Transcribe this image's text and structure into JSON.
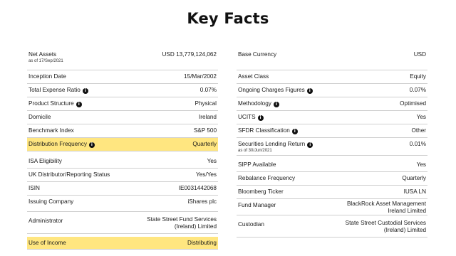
{
  "page": {
    "title": "Key Facts"
  },
  "icons": {
    "info": "info-icon"
  },
  "left": [
    {
      "label": "Net Assets",
      "sub": "as of 17/Sep/2021",
      "value": "USD 13,779,124,062",
      "info": false,
      "highlight": false
    },
    {
      "label": "Inception Date",
      "value": "15/Mar/2002",
      "info": false,
      "highlight": false
    },
    {
      "label": "Total Expense Ratio",
      "value": "0.07%",
      "info": true,
      "highlight": false
    },
    {
      "label": "Product Structure",
      "value": "Physical",
      "info": true,
      "highlight": false
    },
    {
      "label": "Domicile",
      "value": "Ireland",
      "info": false,
      "highlight": false
    },
    {
      "label": "Benchmark Index",
      "value": "S&P 500",
      "info": false,
      "highlight": false
    },
    {
      "label": "Distribution Frequency",
      "value": "Quarterly",
      "info": true,
      "highlight": true
    },
    {
      "label": "ISA Eligibility",
      "value": "Yes",
      "info": false,
      "highlight": false
    },
    {
      "label": "UK Distributor/Reporting Status",
      "value": "Yes/Yes",
      "info": false,
      "highlight": false
    },
    {
      "label": "ISIN",
      "value": "IE0031442068",
      "info": false,
      "highlight": false
    },
    {
      "label": "Issuing Company",
      "value": "iShares plc",
      "info": false,
      "highlight": false
    },
    {
      "label": "Administrator",
      "value_lines": [
        "State Street Fund Services",
        "(Ireland) Limited"
      ],
      "info": false,
      "highlight": false
    },
    {
      "label": "Use of Income",
      "value": "Distributing",
      "info": false,
      "highlight": true
    }
  ],
  "right": [
    {
      "label": "Base Currency",
      "value": "USD",
      "info": false,
      "highlight": false
    },
    {
      "label": "Asset Class",
      "value": "Equity",
      "info": false,
      "highlight": false
    },
    {
      "label": "Ongoing Charges Figures",
      "value": "0.07%",
      "info": true,
      "highlight": false
    },
    {
      "label": "Methodology",
      "value": "Optimised",
      "info": true,
      "highlight": false
    },
    {
      "label": "UCITS",
      "value": "Yes",
      "info": true,
      "highlight": false
    },
    {
      "label": "SFDR Classification",
      "value": "Other",
      "info": true,
      "highlight": false
    },
    {
      "label": "Securities Lending Return",
      "sub": "as of 30/Jun/2021",
      "value": "0.01%",
      "info": true,
      "highlight": false
    },
    {
      "label": "SIPP Available",
      "value": "Yes",
      "info": false,
      "highlight": false
    },
    {
      "label": "Rebalance Frequency",
      "value": "Quarterly",
      "info": false,
      "highlight": false
    },
    {
      "label": "Bloomberg Ticker",
      "value": "IUSA LN",
      "info": false,
      "highlight": false
    },
    {
      "label": "Fund Manager",
      "value_lines": [
        "BlackRock Asset Management",
        "Ireland Limited"
      ],
      "info": false,
      "highlight": false
    },
    {
      "label": "Custodian",
      "value_lines": [
        "State Street Custodial Services",
        "(Ireland) Limited"
      ],
      "info": false,
      "highlight": false
    }
  ]
}
